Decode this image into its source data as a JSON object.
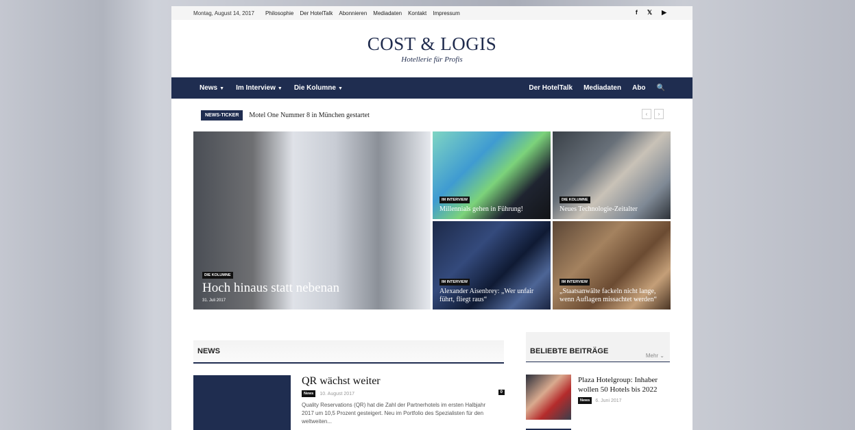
{
  "topbar": {
    "date": "Montag, August 14, 2017",
    "links": [
      "Philosophie",
      "Der HotelTalk",
      "Abonnieren",
      "Mediadaten",
      "Kontakt",
      "Impressum"
    ],
    "social": [
      "f",
      "𝕏",
      "▶"
    ]
  },
  "logo": {
    "title": "COST & LOGIS",
    "subtitle": "Hotellerie für Profis"
  },
  "nav": {
    "left": [
      "News",
      "Im Interview",
      "Die Kolumne"
    ],
    "right": [
      "Der HotelTalk",
      "Mediadaten",
      "Abo"
    ],
    "search_icon": "🔍"
  },
  "ticker": {
    "label": "NEWS-TICKER",
    "text": "Motel One Nummer 8 in München gestartet",
    "prev": "‹",
    "next": "›"
  },
  "featured": {
    "main": {
      "tag": "DIE KOLUMNE",
      "title": "Hoch hinaus statt nebenan",
      "date": "31. Juli 2017"
    },
    "tiles": [
      {
        "tag": "IM INTERVIEW",
        "title": "Millennials gehen in Führung!"
      },
      {
        "tag": "DIE KOLUMNE",
        "title": "Neues Technologie-Zeitalter"
      },
      {
        "tag": "IM INTERVIEW",
        "title": "Alexander Aisenbrey: „Wer unfair führt, fliegt raus“"
      },
      {
        "tag": "IM INTERVIEW",
        "title": "„Staatsanwälte fackeln nicht lange, wenn Auflagen missachtet werden“"
      }
    ]
  },
  "news": {
    "heading": "NEWS",
    "article": {
      "title": "QR wächst weiter",
      "category": "News",
      "date": "10. August 2017",
      "comments": "0",
      "excerpt": "Quality Reservations (QR) hat die Zahl der Partnerhotels im ersten Halbjahr 2017 um 10,5 Prozent gesteigert. Neu im Portfolio des Spezialisten für den weltweiten..."
    }
  },
  "popular": {
    "heading": "BELIEBTE BEITRÄGE",
    "more": "Mehr ⌄",
    "article": {
      "title": "Plaza Hotelgroup: Inhaber wollen 50 Hotels bis 2022",
      "category": "News",
      "date": "6. Juni 2017"
    }
  }
}
